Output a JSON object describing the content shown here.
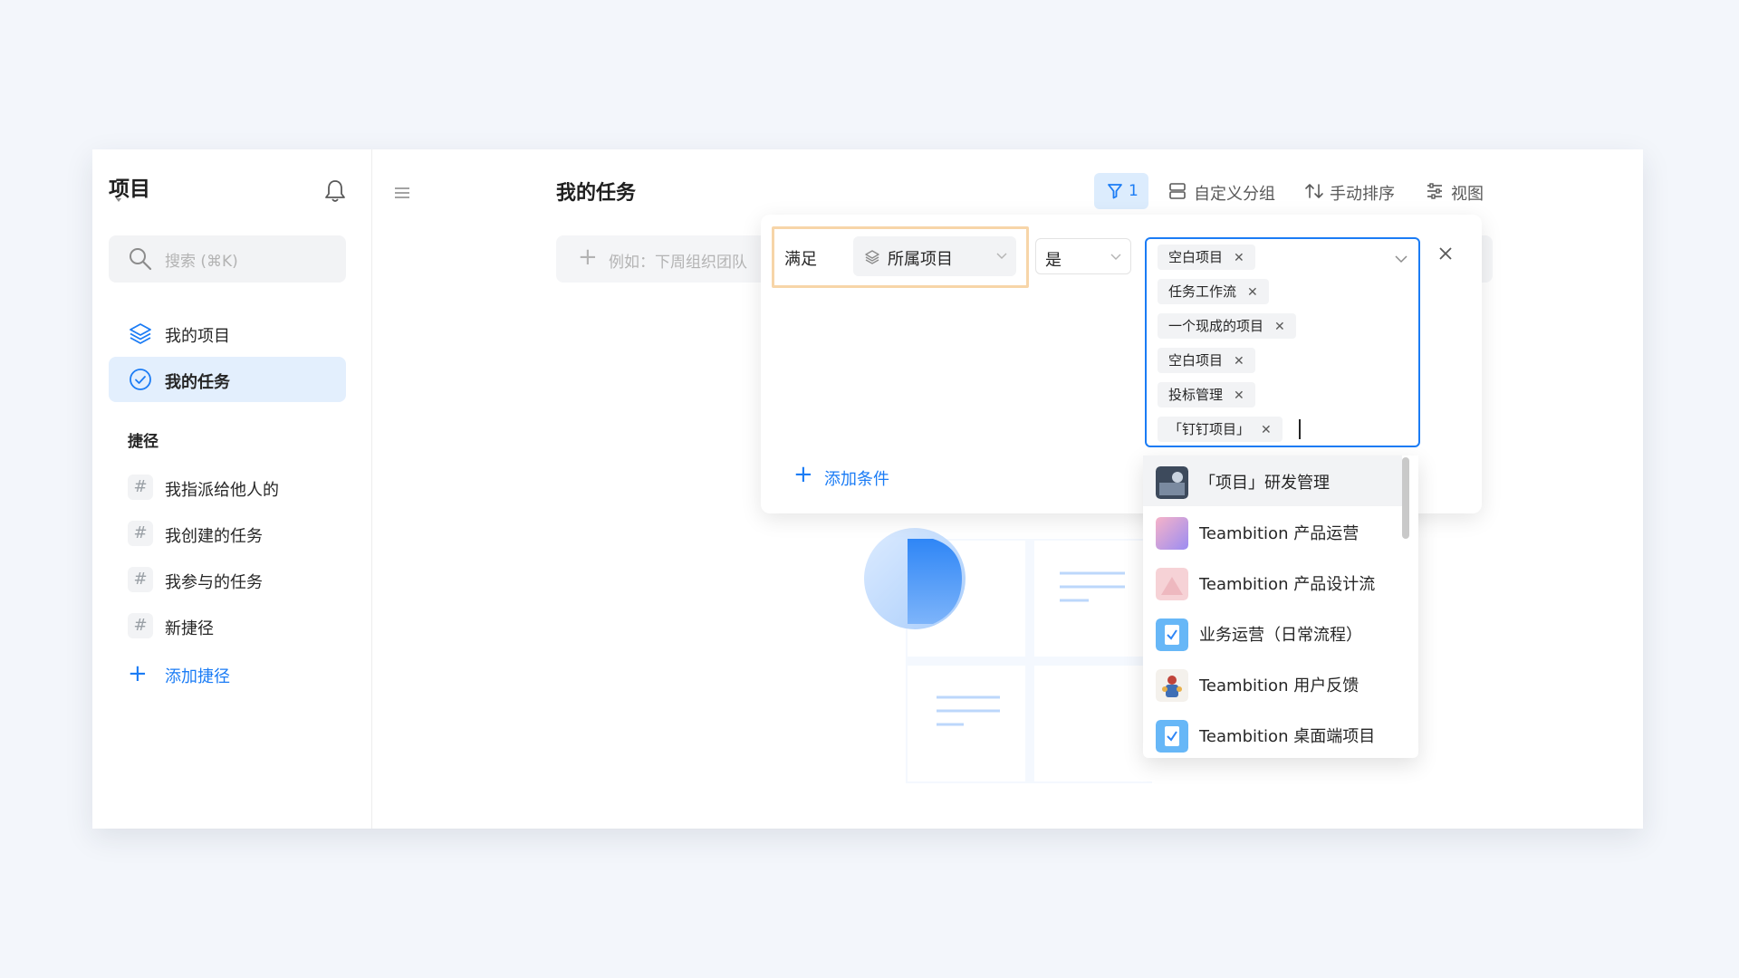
{
  "sidebar": {
    "title": "项目",
    "search_placeholder": "搜索 (⌘K)",
    "nav": [
      {
        "label": "我的项目",
        "icon": "layers-icon"
      },
      {
        "label": "我的任务",
        "icon": "check-circle-icon"
      }
    ],
    "shortcuts_title": "捷径",
    "shortcuts": [
      {
        "label": "我指派给他人的"
      },
      {
        "label": "我创建的任务"
      },
      {
        "label": "我参与的任务"
      },
      {
        "label": "新捷径"
      }
    ],
    "add_shortcut_label": "添加捷径"
  },
  "main": {
    "title": "我的任务",
    "quick_add_placeholder": "例如：下周组织团队",
    "toolbar": {
      "filter_count": "1",
      "group_label": "自定义分组",
      "sort_label": "手动排序",
      "view_label": "视图"
    }
  },
  "filter": {
    "match_label": "满足",
    "field_label": "所属项目",
    "operator_label": "是",
    "selected_values": [
      "空白项目",
      "任务工作流",
      "一个现成的项目",
      "空白项目",
      "投标管理",
      "「钉钉项目」"
    ],
    "add_condition_label": "添加条件",
    "options": [
      {
        "label": "「项目」研发管理"
      },
      {
        "label": "Teambition 产品运营"
      },
      {
        "label": "Teambition 产品设计流"
      },
      {
        "label": "业务运营（日常流程）"
      },
      {
        "label": "Teambition 用户反馈"
      },
      {
        "label": "Teambition 桌面端项目"
      }
    ]
  },
  "colors": {
    "accent": "#1b7cf5",
    "active_bg": "#e3effd",
    "highlight_border": "#f7d5a8"
  }
}
